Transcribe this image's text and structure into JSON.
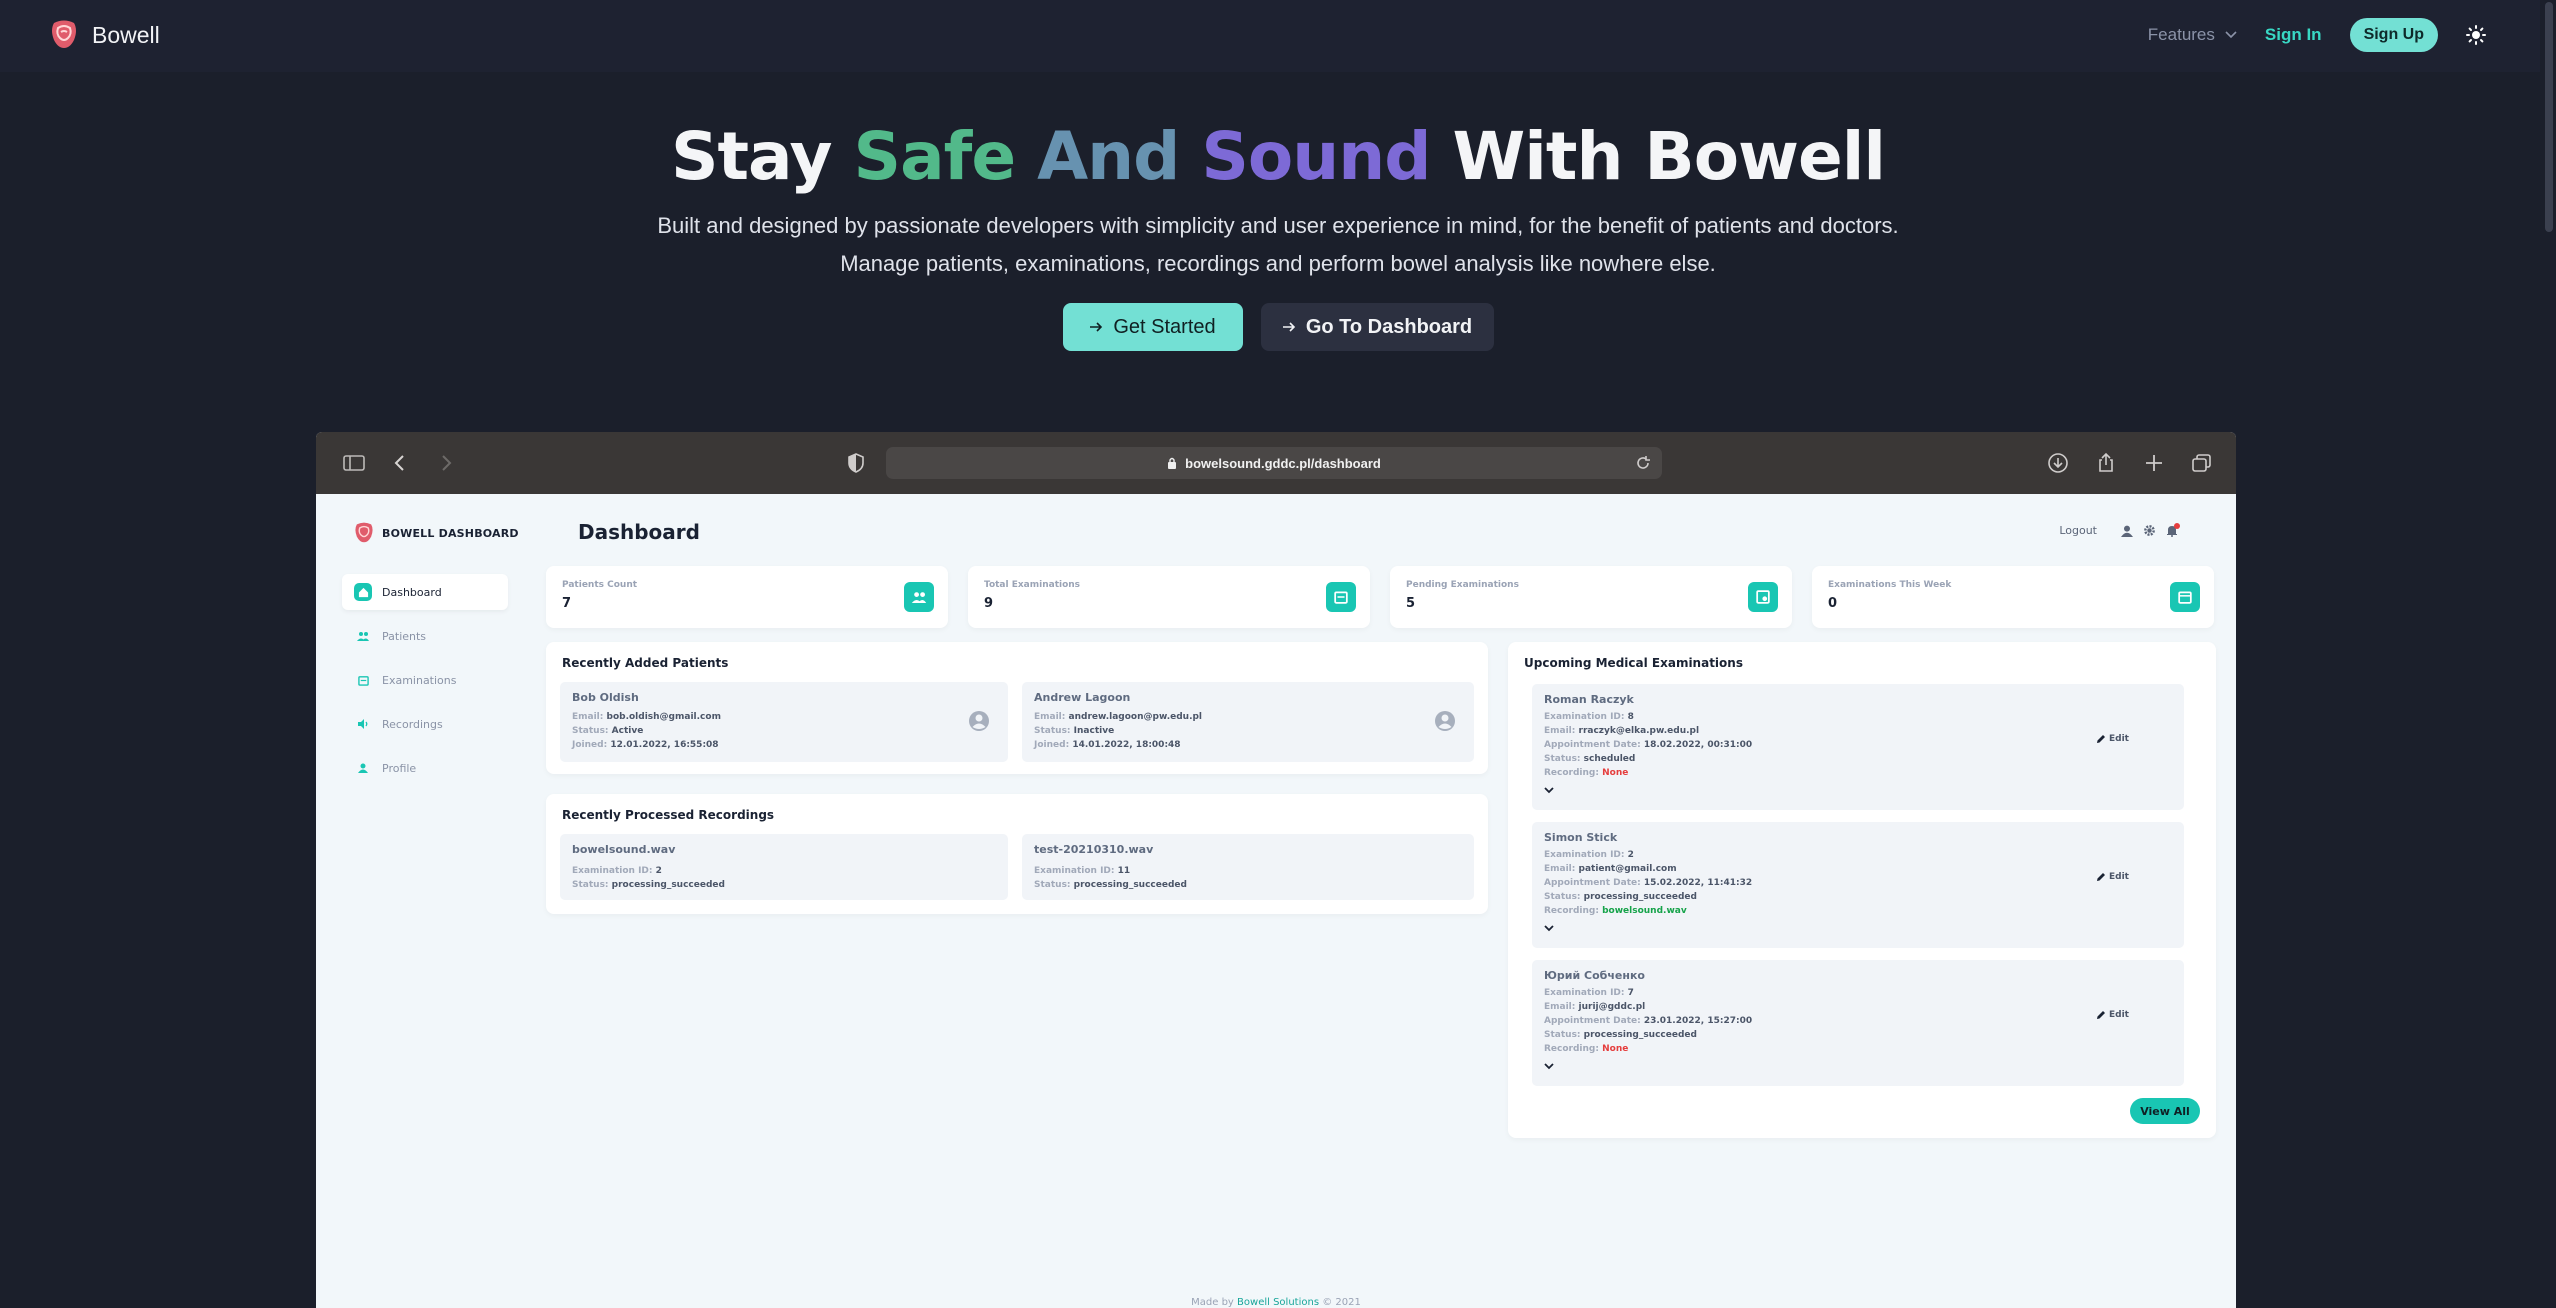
{
  "nav": {
    "brand": "Bowell",
    "features": "Features",
    "signin": "Sign In",
    "signup": "Sign Up"
  },
  "hero": {
    "title_stay": "Stay",
    "title_safe": "Safe",
    "title_and": "And",
    "title_sound": "Sound",
    "title_with": "With Bowell",
    "sub1": "Built and designed by passionate developers with simplicity and user experience in mind, for the benefit of patients and doctors.",
    "sub2": "Manage patients, examinations, recordings and perform bowel analysis like nowhere else.",
    "btn_started": "Get Started",
    "btn_dashboard": "Go To Dashboard"
  },
  "browser": {
    "url": "bowelsound.gddc.pl/dashboard"
  },
  "app": {
    "logo": "BOWELL DASHBOARD",
    "title": "Dashboard",
    "logout": "Logout",
    "sidebar": [
      "Dashboard",
      "Patients",
      "Examinations",
      "Recordings",
      "Profile"
    ],
    "stats": [
      {
        "label": "Patients Count",
        "value": "7"
      },
      {
        "label": "Total Examinations",
        "value": "9"
      },
      {
        "label": "Pending Examinations",
        "value": "5"
      },
      {
        "label": "Examinations This Week",
        "value": "0"
      }
    ],
    "recent_patients_title": "Recently Added Patients",
    "patients": [
      {
        "name": "Bob Oldish",
        "email": "bob.oldish@gmail.com",
        "status": "Active",
        "joined": "12.01.2022, 16:55:08"
      },
      {
        "name": "Andrew Lagoon",
        "email": "andrew.lagoon@pw.edu.pl",
        "status": "Inactive",
        "joined": "14.01.2022, 18:00:48"
      }
    ],
    "recordings_title": "Recently Processed Recordings",
    "recordings": [
      {
        "name": "bowelsound.wav",
        "exam_id": "2",
        "status": "processing_succeeded"
      },
      {
        "name": "test-20210310.wav",
        "exam_id": "11",
        "status": "processing_succeeded"
      }
    ],
    "upcoming_title": "Upcoming Medical Examinations",
    "exams": [
      {
        "name": "Roman Raczyk",
        "exam_id": "8",
        "email": "rraczyk@elka.pw.edu.pl",
        "date": "18.02.2022, 00:31:00",
        "status": "scheduled",
        "recording": "None"
      },
      {
        "name": "Simon Stick",
        "exam_id": "2",
        "email": "patient@gmail.com",
        "date": "15.02.2022, 11:41:32",
        "status": "processing_succeeded",
        "recording": "bowelsound.wav"
      },
      {
        "name": "Юрий Собченко",
        "exam_id": "7",
        "email": "jurij@gddc.pl",
        "date": "23.01.2022, 15:27:00",
        "status": "processing_succeeded",
        "recording": "None"
      }
    ],
    "labels": {
      "email": "Email:",
      "status": "Status:",
      "joined": "Joined:",
      "exam_id": "Examination ID:",
      "appointment": "Appointment Date:",
      "recording": "Recording:",
      "edit": "Edit",
      "view_all": "View All"
    },
    "footer_pre": "Made by",
    "footer_brand": "Bowell Solutions",
    "footer_post": "© 2021"
  },
  "colors": {
    "accent": "#19c6b3",
    "hero_button": "#73e0d4",
    "background": "#1b1f2b"
  }
}
